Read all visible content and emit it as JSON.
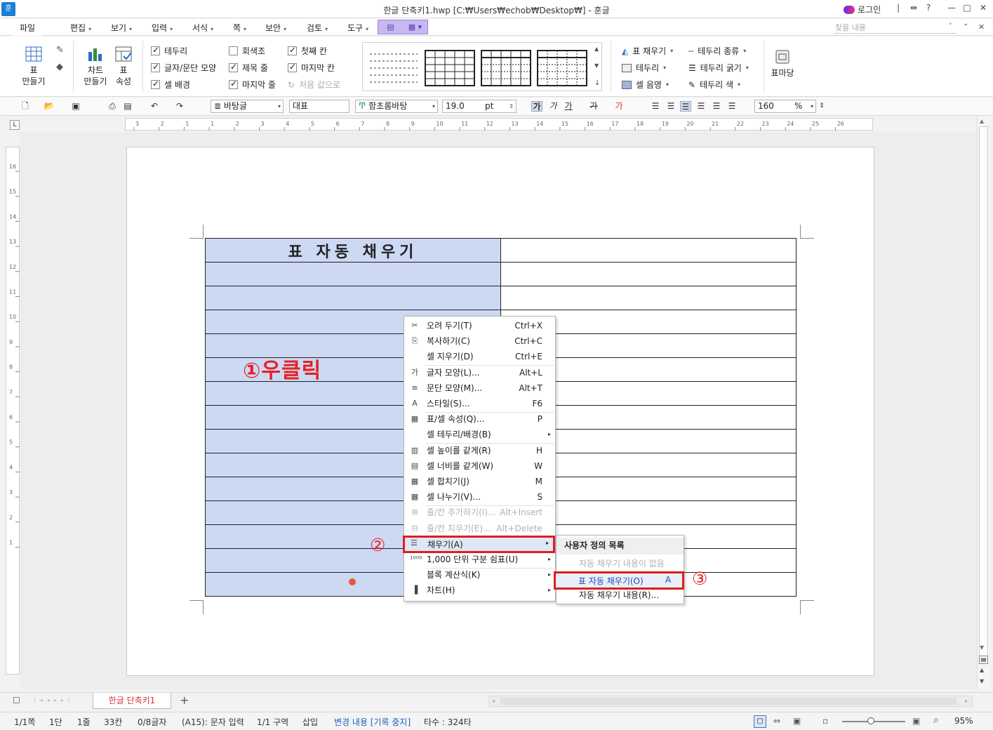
{
  "window": {
    "app_icon": "훈",
    "title": "한글 단축키1.hwp [C:₩Users₩echob₩Desktop₩] - 훈글",
    "login": "로그인",
    "controls": [
      "|",
      "⇹",
      "?",
      "—",
      "□",
      "✕"
    ]
  },
  "menubar": {
    "file": "파일",
    "items": [
      "편집",
      "보기",
      "입력",
      "서식",
      "쪽",
      "보안",
      "검토",
      "도구"
    ],
    "search_placeholder": "찾을 내용",
    "right_icons": [
      "˅",
      "⌃",
      "✕"
    ]
  },
  "ribbon": {
    "table_btn": "표",
    "table_btn_sub": "만들기",
    "chart_btn": "차트",
    "chart_btn_sub": "만들기",
    "props_btn": "표",
    "props_btn_sub": "속성",
    "checks": [
      {
        "label": "테두리",
        "checked": true
      },
      {
        "label": "글자/문단 모양",
        "checked": true
      },
      {
        "label": "셀 배경",
        "checked": true
      },
      {
        "label": "회색조",
        "checked": false
      },
      {
        "label": "제목 줄",
        "checked": true
      },
      {
        "label": "마지막 줄",
        "checked": true
      },
      {
        "label": "첫째 칸",
        "checked": true
      },
      {
        "label": "마지막 칸",
        "checked": true
      }
    ],
    "reset_label": "처음 값으로",
    "fill_items": [
      "표 채우기",
      "테두리",
      "셀 음영"
    ],
    "border_items": [
      "테두리 종류",
      "테두리 굵기",
      "테두리 색"
    ],
    "mailmerge_label": "표마당"
  },
  "toolbar2": {
    "style_combo": "바탕글",
    "para_combo": "대표",
    "font_combo": "함초롬바탕",
    "size_value": "19.0",
    "size_unit": "pt",
    "zoom_value": "160",
    "zoom_unit": "%",
    "fmt_labels": [
      "가",
      "가",
      "가",
      "가",
      "가"
    ]
  },
  "ruler": {
    "h_ticks": [
      "3",
      "2",
      "1",
      "1",
      "2",
      "3",
      "4",
      "5",
      "6",
      "7",
      "8",
      "9",
      "10",
      "11",
      "12",
      "13",
      "14",
      "15",
      "16",
      "17",
      "18",
      "19",
      "20",
      "21",
      "22",
      "23",
      "24",
      "25",
      "26"
    ],
    "v_ticks": [
      "16",
      "15",
      "14",
      "13",
      "12",
      "11",
      "10",
      "9",
      "8",
      "7",
      "6",
      "5",
      "4",
      "3",
      "2",
      "1"
    ],
    "corner": "L"
  },
  "document": {
    "table_title": "표 자동 채우기",
    "row_count": 15
  },
  "annotations": {
    "right_click": "①우클릭",
    "step2": "②",
    "step3": "③"
  },
  "context_menu": [
    {
      "icon": "✂",
      "label": "오려 두기(T)",
      "shortcut": "Ctrl+X"
    },
    {
      "icon": "⎘",
      "label": "복사하기(C)",
      "shortcut": "Ctrl+C"
    },
    {
      "icon": "",
      "label": "셀 지우기(D)",
      "shortcut": "Ctrl+E"
    },
    {
      "icon": "가",
      "label": "글자 모양(L)...",
      "shortcut": "Alt+L"
    },
    {
      "icon": "≡",
      "label": "문단 모양(M)...",
      "shortcut": "Alt+T"
    },
    {
      "icon": "A",
      "label": "스타일(S)...",
      "shortcut": "F6"
    },
    {
      "icon": "▦",
      "label": "표/셀 속성(Q)...",
      "shortcut": "P"
    },
    {
      "icon": "",
      "label": "셀 테두리/배경(B)",
      "shortcut": "▸"
    },
    {
      "icon": "▥",
      "label": "셀 높이를 같게(R)",
      "shortcut": "H"
    },
    {
      "icon": "▤",
      "label": "셀 너비를 같게(W)",
      "shortcut": "W"
    },
    {
      "icon": "▦",
      "label": "셀 합치기(J)",
      "shortcut": "M"
    },
    {
      "icon": "▦",
      "label": "셀 나누기(V)...",
      "shortcut": "S"
    },
    {
      "icon": "⊞",
      "label": "줄/칸 추가하기(I)...",
      "shortcut": "Alt+Insert"
    },
    {
      "icon": "⊟",
      "label": "줄/칸 지우기(E)...",
      "shortcut": "Alt+Delete"
    },
    {
      "icon": "☰",
      "label": "채우기(A)",
      "shortcut": "▸"
    },
    {
      "icon": "¹⁰⁰⁰",
      "label": "1,000 단위 구분 쉼표(U)",
      "shortcut": "▸"
    },
    {
      "icon": "",
      "label": "블록 계산식(K)",
      "shortcut": "▸"
    },
    {
      "icon": "▐",
      "label": "차트(H)",
      "shortcut": "▸"
    }
  ],
  "submenu": {
    "header": "사용자 정의 목록",
    "empty": "자동 채우기 내용이 없음",
    "auto_fill": "표 자동 채우기(O)",
    "auto_fill_key": "A",
    "auto_fill_content": "자동 채우기 내용(R)..."
  },
  "tabbar": {
    "doc_tab": "한글 단축키1",
    "add": "+"
  },
  "statusbar": {
    "page": "1/1쪽",
    "column": "1단",
    "line": "1줄",
    "col": "33칸",
    "chars": "0/8글자",
    "cell_mode": "(A15): 문자 입력",
    "section": "1/1 구역",
    "insert": "삽입",
    "track": "변경 내용 [기록 중지]",
    "typing": "타수 : 324타",
    "zoom": "95%"
  }
}
